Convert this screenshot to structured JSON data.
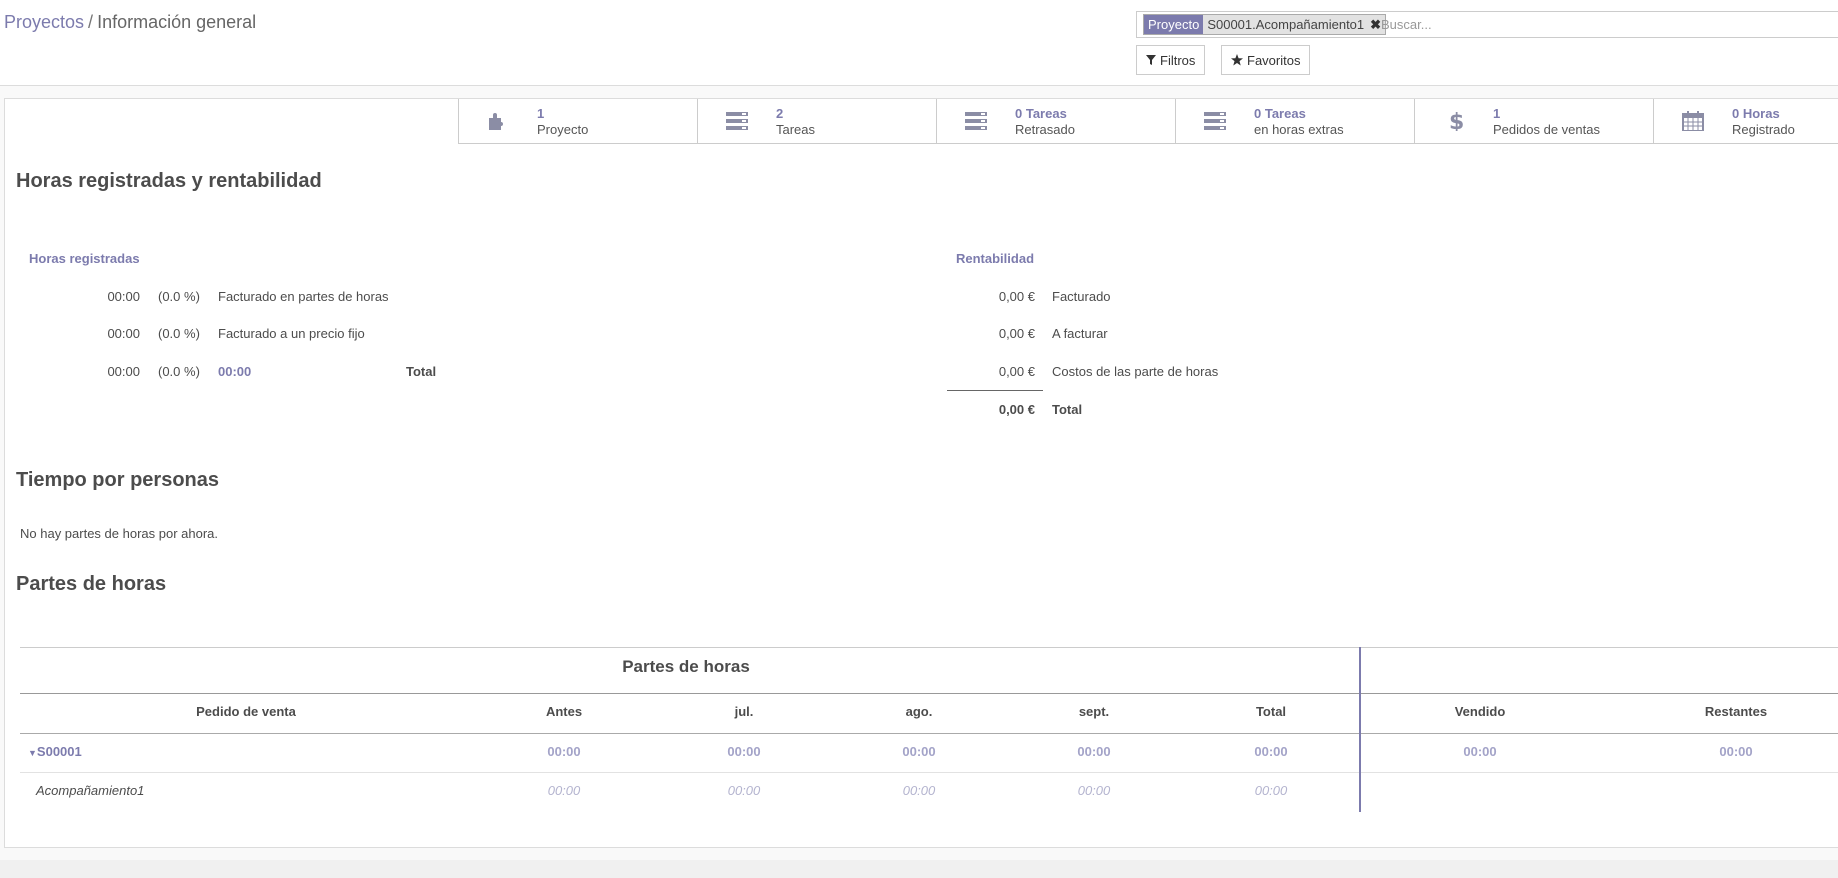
{
  "breadcrumb": {
    "parent": "Proyectos",
    "separator": "/",
    "current": "Información general"
  },
  "search": {
    "facet_category": "Proyecto",
    "facet_value": "S00001.Acompañamiento1",
    "facet_remove": "✖",
    "placeholder": "Buscar..."
  },
  "toolbar": {
    "filters_label": "Filtros",
    "favorites_label": "Favoritos"
  },
  "stats": [
    {
      "icon": "puzzle-icon",
      "number": "1",
      "label": "Proyecto"
    },
    {
      "icon": "tasks-icon",
      "number": "2",
      "label": "Tareas"
    },
    {
      "icon": "tasks-icon",
      "number": "0  Tareas",
      "label": "Retrasado"
    },
    {
      "icon": "tasks-icon",
      "number": "0  Tareas",
      "label": "en horas extras"
    },
    {
      "icon": "dollar-icon",
      "number": "1",
      "label": "Pedidos de ventas"
    },
    {
      "icon": "calendar-icon",
      "number": "0  Horas",
      "label": "Registrado"
    }
  ],
  "hours_section": {
    "title": "Horas registradas y rentabilidad",
    "hours_heading": "Horas registradas",
    "hours_rows": [
      {
        "time": "00:00",
        "pct": "(0.0 %)",
        "label": "Facturado en partes de horas"
      },
      {
        "time": "00:00",
        "pct": "(0.0 %)",
        "label": "Facturado a un precio fijo"
      }
    ],
    "hours_total": {
      "time": "00:00",
      "pct": "(0.0 %)",
      "value": "00:00",
      "label": "Total"
    },
    "profit_heading": "Rentabilidad",
    "profit_rows": [
      {
        "amount": "0,00 €",
        "label": "Facturado"
      },
      {
        "amount": "0,00 €",
        "label": "A facturar"
      },
      {
        "amount": "0,00 €",
        "label": "Costos de las parte de horas"
      }
    ],
    "profit_total": {
      "amount": "0,00 €",
      "label": "Total"
    }
  },
  "people_section": {
    "title": "Tiempo por personas",
    "empty_text": "No hay partes de horas por ahora."
  },
  "timesheets_section": {
    "title": "Partes de horas",
    "table_caption": "Partes de horas",
    "columns": [
      "Pedido de venta",
      "Antes",
      "jul.",
      "ago.",
      "sept.",
      "Total",
      "Vendido",
      "Restantes"
    ],
    "group_row": {
      "name": "S00001",
      "values": [
        "00:00",
        "00:00",
        "00:00",
        "00:00",
        "00:00",
        "00:00",
        "00:00"
      ]
    },
    "line_row": {
      "name": "Acompañamiento1",
      "values": [
        "00:00",
        "00:00",
        "00:00",
        "00:00",
        "00:00"
      ]
    }
  },
  "colors": {
    "accent": "#7c7bad",
    "text": "#4c4c4c",
    "muted_value": "#a3a3c8"
  }
}
